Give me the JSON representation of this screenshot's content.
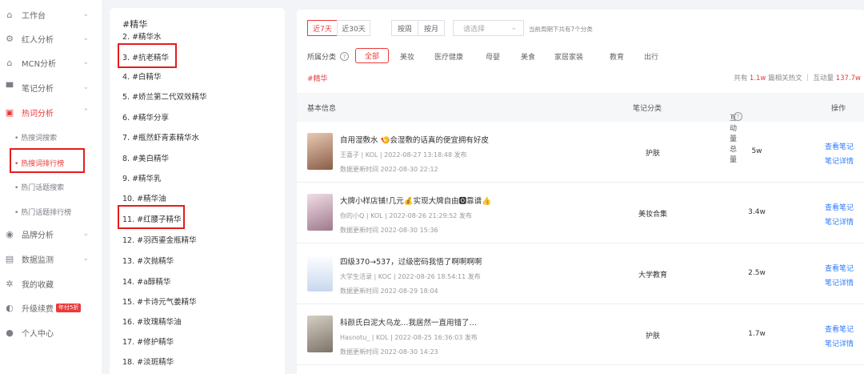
{
  "sidebar": {
    "items": [
      {
        "label": "工作台",
        "icon": "home-icon"
      },
      {
        "label": "红人分析",
        "icon": "gear-icon"
      },
      {
        "label": "MCN分析",
        "icon": "building-icon"
      },
      {
        "label": "笔记分析",
        "icon": "note-icon"
      },
      {
        "label": "热词分析",
        "icon": "hotword-icon"
      },
      {
        "label": "品牌分析",
        "icon": "brand-icon"
      },
      {
        "label": "数据监测",
        "icon": "monitor-icon"
      },
      {
        "label": "我的收藏",
        "icon": "star-icon"
      },
      {
        "label": "升级续费",
        "icon": "upgrade-icon",
        "badge": "年付5折"
      },
      {
        "label": "个人中心",
        "icon": "user-icon"
      }
    ],
    "sub_items": [
      {
        "label": "• 热搜词搜索"
      },
      {
        "label": "• 热搜词排行榜"
      },
      {
        "label": "• 热门话题搜索"
      },
      {
        "label": "• 热门话题排行榜"
      }
    ]
  },
  "ranking": {
    "header": "#精华",
    "items": [
      "2. #精华水",
      "3. #抗老精华",
      "4. #白精华",
      "5. #娇兰第二代双效精华",
      "6. #精华分享",
      "7. #瓶然虾青素精华水",
      "8. #美白精华",
      "9. #精华乳",
      "10. #精华油",
      "11. #红腰子精华",
      "12. #羽西鎏金瓶精华",
      "13. #次抛精华",
      "14. #a醇精华",
      "15. #卡诗元气姜精华",
      "16. #玫瑰精华油",
      "17. #修护精华",
      "18. #淡斑精华"
    ]
  },
  "filters": {
    "time_tabs": [
      "近7天",
      "近30天"
    ],
    "period_tabs": [
      "按周",
      "按月"
    ],
    "select_placeholder": "请选择",
    "hint": "当前周期下共有7个分类",
    "category_label": "所属分类",
    "categories": [
      "全部",
      "美妆",
      "医疗健康",
      "母婴",
      "美食",
      "家居家装",
      "教育",
      "出行"
    ]
  },
  "keyword": "#精华",
  "summary": {
    "prefix": "共有",
    "count": "1.1w",
    "mid": "篇相关热文 ｜ 互动量",
    "interact": "137.7w"
  },
  "table": {
    "headers": [
      "基本信息",
      "笔记分类",
      "互动量总量",
      "操作"
    ],
    "rows": [
      {
        "title": "自用湿敷水 🍤会湿敷的话真的便宜拥有好皮",
        "meta": "王喜子 | KOL | 2022-08-27 13:18:48 发布",
        "update": "数据更新时间 2022-08-30 22:12",
        "category": "护肤",
        "interact": "5w",
        "actions": [
          "查看笔记",
          "笔记详情"
        ],
        "thumb_color": "#b58a73"
      },
      {
        "title": "大牌小样店铺!几元💰实现大牌自由🅾靠谱👍",
        "meta": "你的小Q | KOL | 2022-08-26 21:29:52 发布",
        "update": "数据更新时间 2022-08-30 15:36",
        "category": "美妆合集",
        "interact": "3.4w",
        "actions": [
          "查看笔记",
          "笔记详情"
        ],
        "thumb_color": "#c9a4b6"
      },
      {
        "title": "四级370→537，过级密码我悟了啊啊啊啊",
        "meta": "大学生活录 | KOC | 2022-08-26 18:54:11 发布",
        "update": "数据更新时间 2022-08-29 18:04",
        "category": "大学教育",
        "interact": "2.5w",
        "actions": [
          "查看笔记",
          "笔记详情"
        ],
        "thumb_color": "#dbe6f5"
      },
      {
        "title": "科颜氏白泥大乌龙…我居然一直用错了…",
        "meta": "Hasnotu_ | KOL | 2022-08-25 16:36:03 发布",
        "update": "数据更新时间 2022-08-30 14:23",
        "category": "护肤",
        "interact": "1.7w",
        "actions": [
          "查看笔记",
          "笔记详情"
        ],
        "thumb_color": "#a79f93"
      }
    ]
  },
  "colors": {
    "accent": "#ea3a3a",
    "link": "#2f7bff",
    "highlight": "#e51c1c"
  }
}
